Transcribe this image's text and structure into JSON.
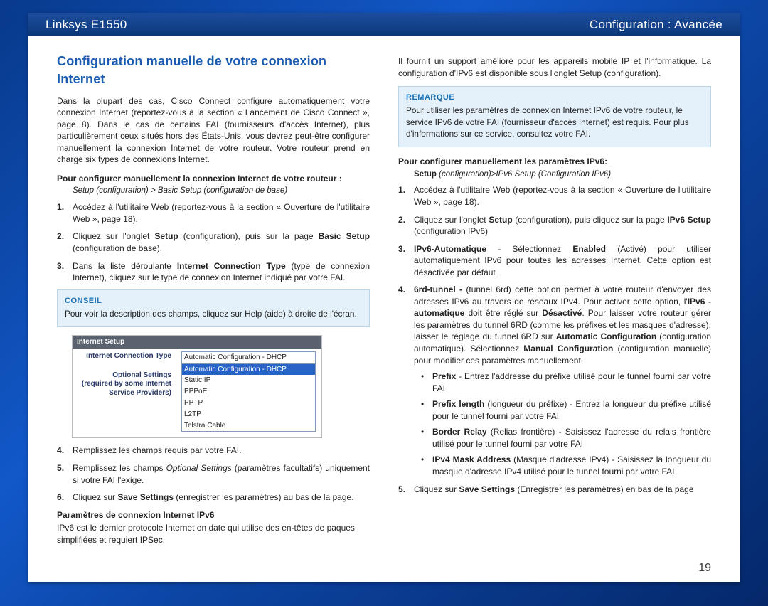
{
  "header": {
    "left": "Linksys E1550",
    "right": "Configuration : Avancée"
  },
  "page_number": "19",
  "left_col": {
    "section_title": "Configuration manuelle de votre connexion Internet",
    "intro": "Dans la plupart des cas, Cisco Connect configure automatiquement votre connexion Internet (reportez-vous à la section « Lancement de Cisco Connect », page 8). Dans le cas de certains FAI (fournisseurs d'accès Internet), plus particulièrement ceux situés hors des États-Unis, vous devrez peut-être configurer manuellement la connexion Internet de votre routeur. Votre routeur prend en charge six types de connexions Internet.",
    "sub1": "Pour configurer manuellement la connexion Internet de votre routeur :",
    "breadcrumb1": "Setup (configuration) > Basic Setup (configuration de base)",
    "step1": "Accédez à l'utilitaire Web (reportez-vous à la section « Ouverture de l'utilitaire Web », page 18).",
    "step2a": "Cliquez sur l'onglet ",
    "step2b": "Setup",
    "step2c": " (configuration), puis sur la page ",
    "step2d": "Basic Setup",
    "step2e": " (configuration de base).",
    "step3a": "Dans la liste déroulante ",
    "step3b": "Internet Connection Type",
    "step3c": " (type de connexion Internet), cliquez sur le type de connexion Internet indiqué par votre FAI.",
    "conseil_label": "CONSEIL",
    "conseil_body": "Pour voir la description des champs, cliquez sur Help (aide) à droite de l'écran.",
    "shot": {
      "bar": "Internet Setup",
      "label_main": "Internet Connection Type",
      "label_sub1": "Optional Settings",
      "label_sub2": "(required by some Internet",
      "label_sub3": "Service Providers)",
      "optsel": "Automatic Configuration - DHCP",
      "opt1": "Automatic Configuration - DHCP",
      "opt2": "Static IP",
      "opt3": "PPPoE",
      "opt4": "PPTP",
      "opt5": "L2TP",
      "opt6": "Telstra Cable"
    },
    "step4": "Remplissez les champs requis par votre FAI.",
    "step5a": "Remplissez les champs ",
    "step5b": "Optional Settings",
    "step5c": " (paramètres facultatifs) uniquement si votre FAI l'exige.",
    "step6a": "Cliquez sur ",
    "step6b": "Save Settings",
    "step6c": " (enregistrer les paramètres) au bas de la page.",
    "sub2": "Paramètres de connexion Internet IPv6",
    "ipv6_intro": "IPv6 est le dernier protocole Internet en date qui utilise des en-têtes de paques simplifiées et requiert IPSec."
  },
  "right_col": {
    "cont": "Il fournit un support amélioré pour les appareils mobile IP et l'informatique. La configuration d'IPv6 est disponible sous l'onglet Setup (configuration).",
    "remarque_label": "REMARQUE",
    "remarque_body": "Pour utiliser les paramètres de connexion Internet IPv6 de votre routeur, le service IPv6 de votre FAI (fournisseur d'accès Internet) est requis. Pour plus d'informations sur ce service, consultez votre FAI.",
    "sub1": "Pour configurer manuellement les paramètres IPv6:",
    "breadcrumb1a": "Setup ",
    "breadcrumb1b": "(configuration)>IPv6 Setup (Configuration IPv6)",
    "step1": "Accédez à l'utilitaire Web (reportez-vous à la section « Ouverture de l'utilitaire Web », page 18).",
    "step2a": "Cliquez sur l'onglet ",
    "step2b": "Setup",
    "step2c": " (configuration), puis cliquez sur la page ",
    "step2d": "IPv6 Setup",
    "step2e": " (configuration IPv6)",
    "step3a": "IPv6-Automatique",
    "step3b": " - Sélectionnez ",
    "step3c": "Enabled",
    "step3d": " (Activé) pour utiliser automatiquement IPv6 pour toutes les adresses Internet. Cette option est désactivée par défaut",
    "step4a": "6rd-tunnel - ",
    "step4b": "(tunnel 6rd) cette option permet à votre routeur d'envoyer des adresses IPv6 au travers de réseaux IPv4. Pour activer cette option, l'",
    "step4c": "IPv6 - automatique",
    "step4d": " doit être réglé sur ",
    "step4e": "Désactivé",
    "step4f": ". Pour laisser votre routeur gérer les paramètres du tunnel 6RD (comme les préfixes et les masques d'adresse), laisser le réglage du tunnel 6RD sur ",
    "step4g": "Automatic Configuration",
    "step4h": " (configuration automatique). Sélectionnez ",
    "step4i": "Manual Configuration",
    "step4j": " (configuration manuelle) pour modifier ces paramètres manuellement.",
    "b1a": "Prefix",
    "b1b": " - Entrez l'addresse du préfixe utilisé pour le tunnel fourni par votre FAI",
    "b2a": "Prefix length",
    "b2b": " (longueur du préfixe) - Entrez la longueur du préfixe utilisé pour le tunnel fourni par votre FAI",
    "b3a": "Border Relay",
    "b3b": " (Relias frontière) - Saisissez l'adresse du relais frontière utilisé pour le tunnel fourni par votre FAI",
    "b4a": "IPv4 Mask Address",
    "b4b": " (Masque d'adresse IPv4) - Saisissez la longueur du masque d'adresse IPv4 utilisé pour le tunnel fourni par votre FAI",
    "step5a": "Cliquez sur ",
    "step5b": "Save Settings",
    "step5c": " (Enregistrer les paramètres) en bas de la page"
  }
}
